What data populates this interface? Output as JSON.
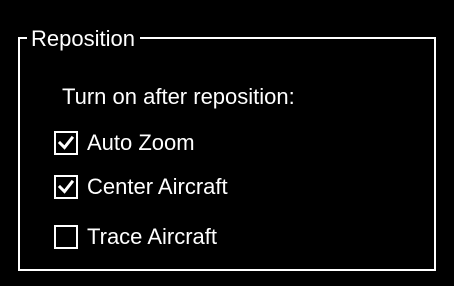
{
  "group": {
    "title": "Reposition"
  },
  "subtitle": "Turn on after reposition:",
  "options": [
    {
      "label": "Auto Zoom",
      "checked": true
    },
    {
      "label": "Center Aircraft",
      "checked": true
    },
    {
      "label": "Trace Aircraft",
      "checked": false
    }
  ],
  "colors": {
    "background": "#000000",
    "foreground": "#ffffff"
  },
  "icons": {
    "checked": "checkmark-icon"
  }
}
